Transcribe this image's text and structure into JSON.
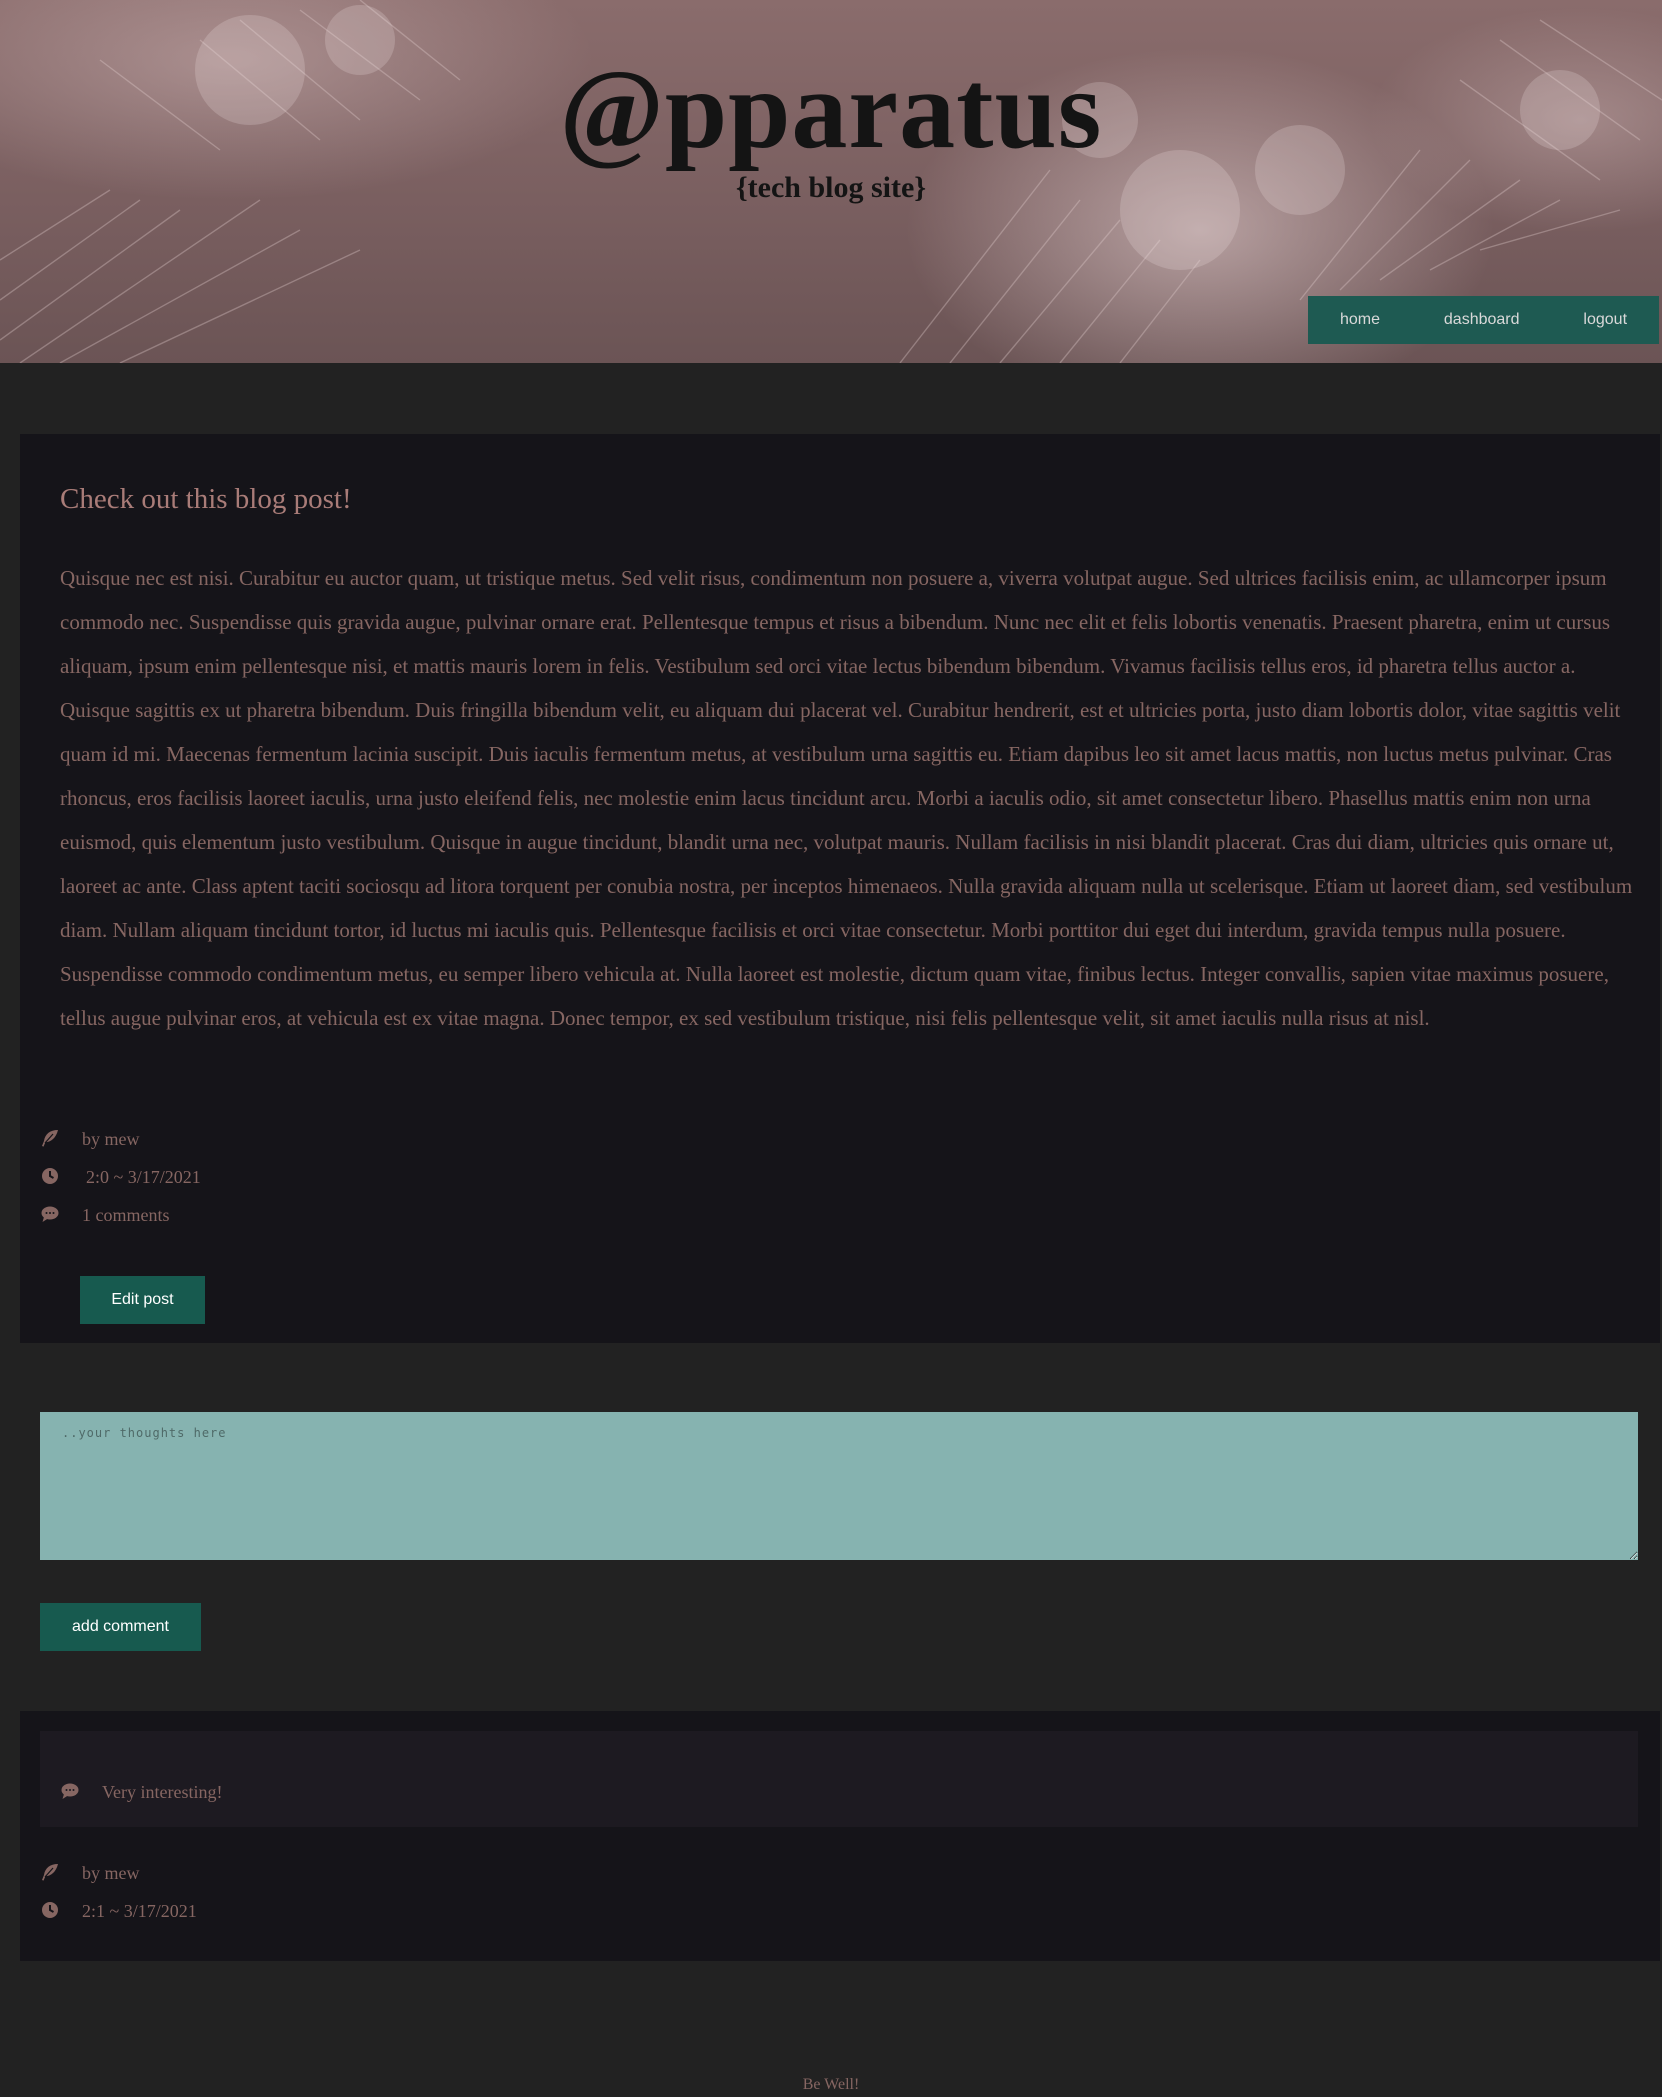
{
  "header": {
    "title": "@pparatus",
    "subtitle": "{tech blog site}"
  },
  "nav": [
    {
      "label": "home"
    },
    {
      "label": "dashboard"
    },
    {
      "label": "logout"
    }
  ],
  "post": {
    "title": "Check out this blog post!",
    "body": "Quisque nec est nisi. Curabitur eu auctor quam, ut tristique metus. Sed velit risus, condimentum non posuere a, viverra volutpat augue. Sed ultrices facilisis enim, ac ullamcorper ipsum commodo nec. Suspendisse quis gravida augue, pulvinar ornare erat. Pellentesque tempus et risus a bibendum. Nunc nec elit et felis lobortis venenatis. Praesent pharetra, enim ut cursus aliquam, ipsum enim pellentesque nisi, et mattis mauris lorem in felis. Vestibulum sed orci vitae lectus bibendum bibendum. Vivamus facilisis tellus eros, id pharetra tellus auctor a. Quisque sagittis ex ut pharetra bibendum. Duis fringilla bibendum velit, eu aliquam dui placerat vel. Curabitur hendrerit, est et ultricies porta, justo diam lobortis dolor, vitae sagittis velit quam id mi. Maecenas fermentum lacinia suscipit. Duis iaculis fermentum metus, at vestibulum urna sagittis eu. Etiam dapibus leo sit amet lacus mattis, non luctus metus pulvinar. Cras rhoncus, eros facilisis laoreet iaculis, urna justo eleifend felis, nec molestie enim lacus tincidunt arcu. Morbi a iaculis odio, sit amet consectetur libero. Phasellus mattis enim non urna euismod, quis elementum justo vestibulum. Quisque in augue tincidunt, blandit urna nec, volutpat mauris. Nullam facilisis in nisi blandit placerat. Cras dui diam, ultricies quis ornare ut, laoreet ac ante. Class aptent taciti sociosqu ad litora torquent per conubia nostra, per inceptos himenaeos. Nulla gravida aliquam nulla ut scelerisque. Etiam ut laoreet diam, sed vestibulum diam. Nullam aliquam tincidunt tortor, id luctus mi iaculis quis. Pellentesque facilisis et orci vitae consectetur. Morbi porttitor dui eget dui interdum, gravida tempus nulla posuere. Suspendisse commodo condimentum metus, eu semper libero vehicula at. Nulla laoreet est molestie, dictum quam vitae, finibus lectus. Integer convallis, sapien vitae maximus posuere, tellus augue pulvinar eros, at vehicula est ex vitae magna. Donec tempor, ex sed vestibulum tristique, nisi felis pellentesque velit, sit amet iaculis nulla risus at nisl.",
    "author": "by mew",
    "time": "2:0 ~ 3/17/2021",
    "comments_count": "1 comments",
    "edit_label": "Edit post"
  },
  "comment_form": {
    "placeholder": "..your thoughts here",
    "submit_label": "add comment"
  },
  "comments": [
    {
      "text": "Very interesting!",
      "author": "by mew",
      "time": "2:1 ~ 3/17/2021"
    }
  ],
  "footer": {
    "text": "Be Well!"
  },
  "icons": {
    "author": "feather-icon",
    "time": "clock-icon",
    "comments": "comment-icon"
  },
  "colors": {
    "page_bg": "#222222",
    "card_bg": "#151419",
    "text": "#866662",
    "accent": "#175a4f",
    "comment_box": "#86b3b0"
  }
}
